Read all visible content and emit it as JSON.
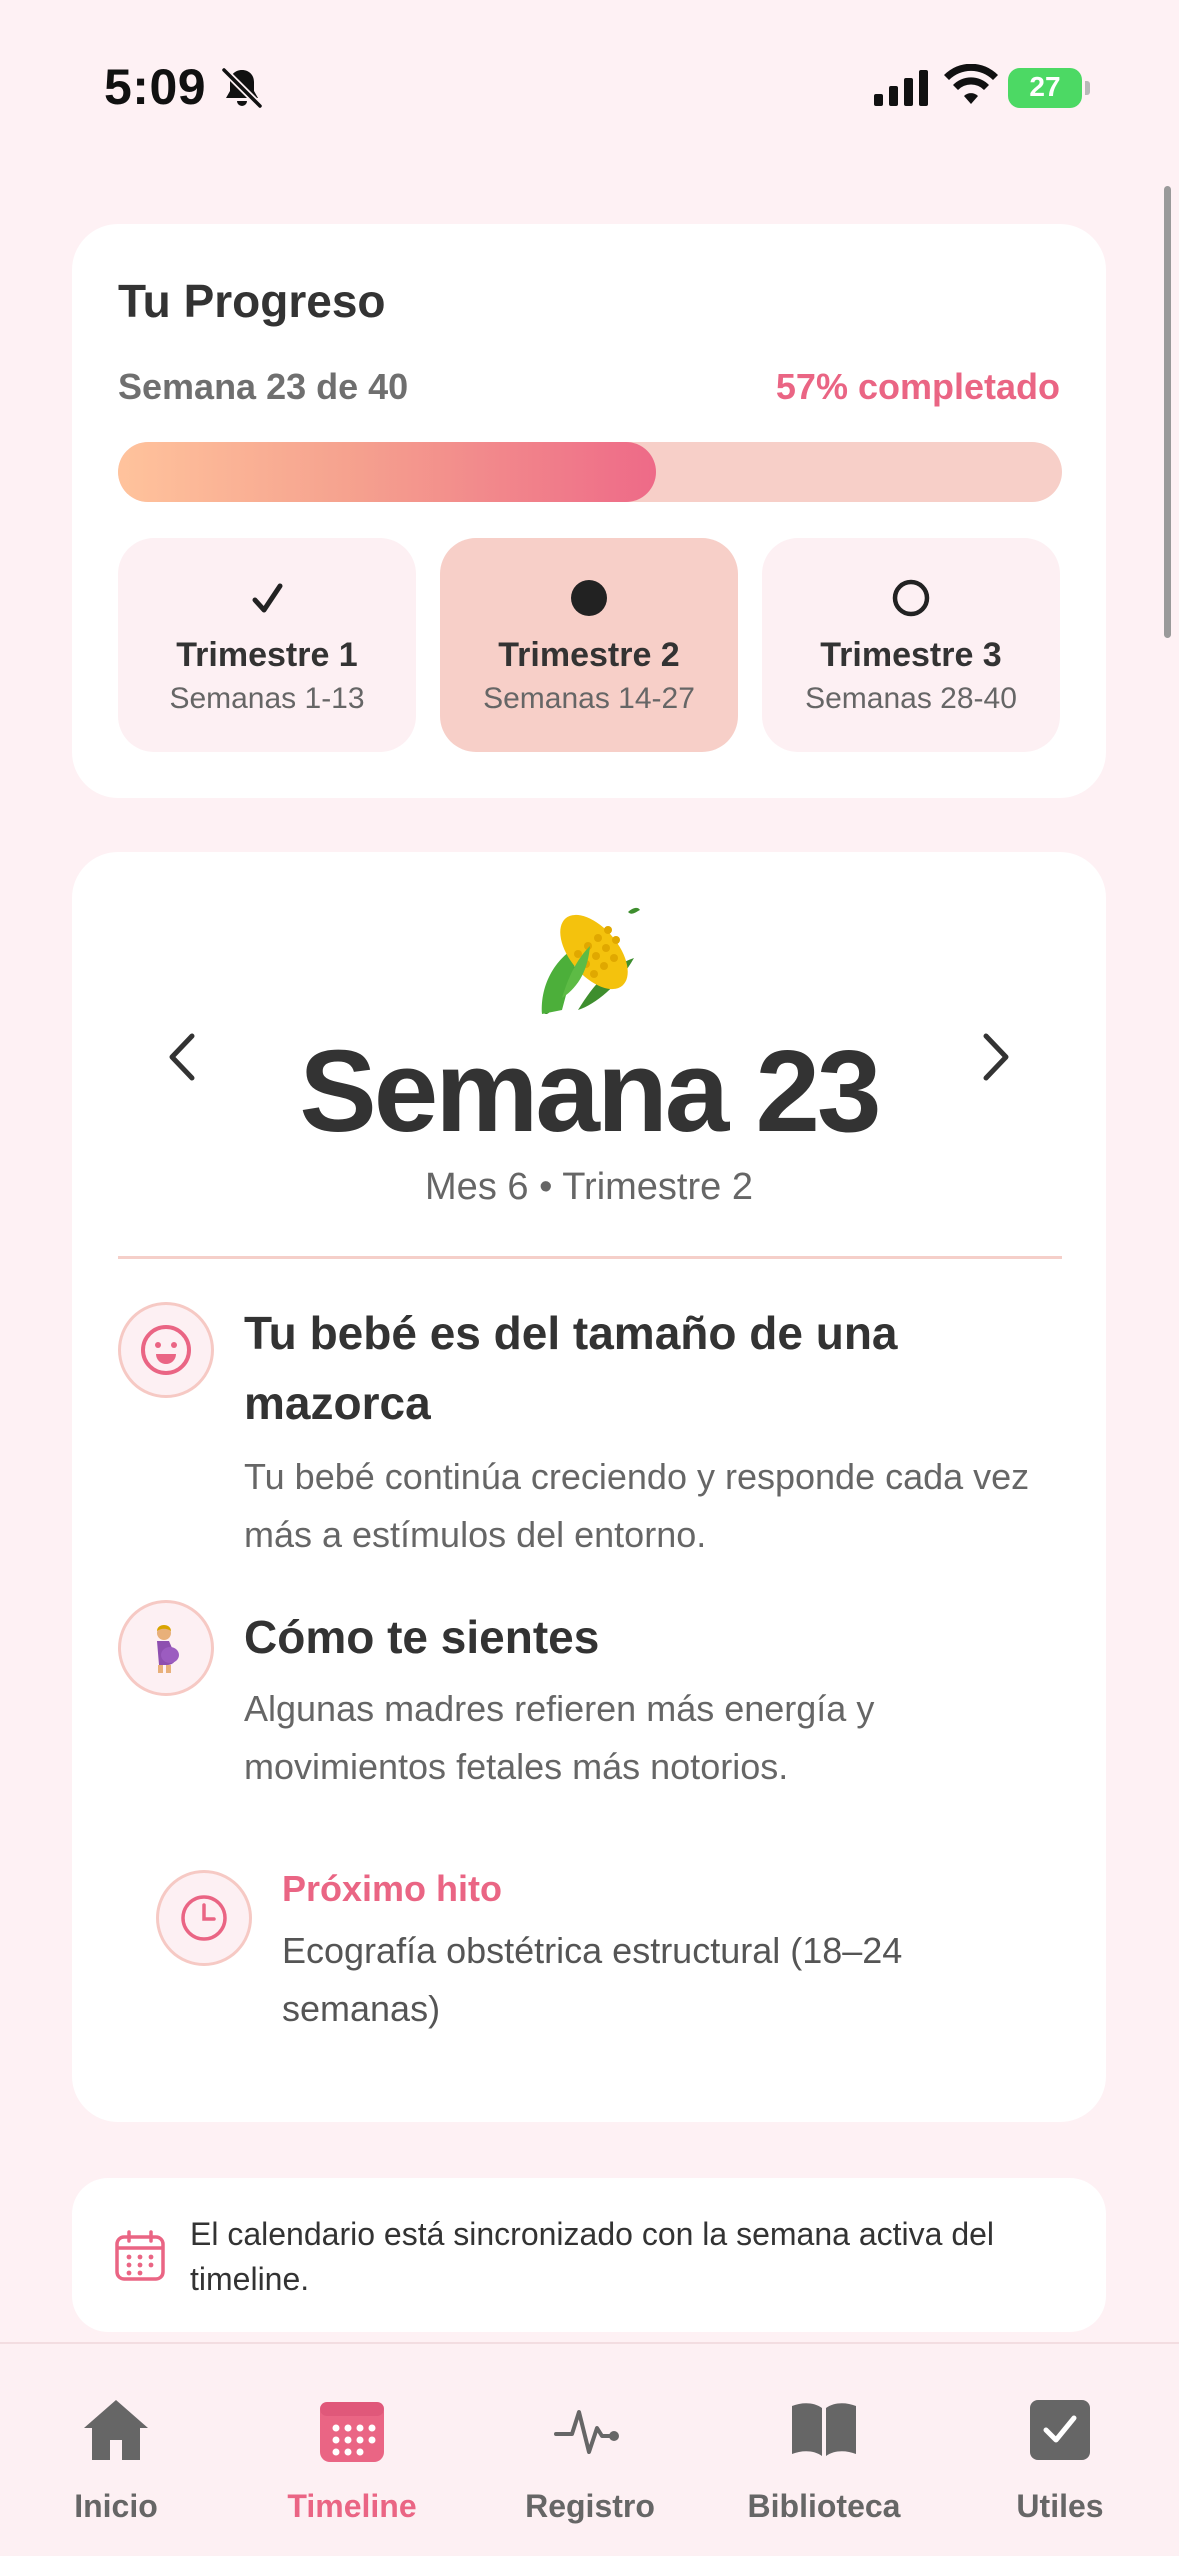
{
  "status_bar": {
    "time": "5:09",
    "battery": "27"
  },
  "progress": {
    "title": "Tu Progreso",
    "week_of": "Semana 23 de 40",
    "percent_label": "57% completado",
    "percent_value": 57,
    "trimesters": [
      {
        "title": "Trimestre 1",
        "weeks": "Semanas 1-13",
        "state": "completed"
      },
      {
        "title": "Trimestre 2",
        "weeks": "Semanas 14-27",
        "state": "current"
      },
      {
        "title": "Trimestre 3",
        "weeks": "Semanas 28-40",
        "state": "upcoming"
      }
    ]
  },
  "week": {
    "emoji_icon": "corn",
    "title": "Semana 23",
    "meta": "Mes 6 • Trimestre 2",
    "baby_size_title": "Tu bebé es del tamaño de una mazorca",
    "baby_size_text": "Tu bebé continúa creciendo y responde cada vez más a estímulos del entorno.",
    "feel_title": "Cómo te sientes",
    "feel_text": "Algunas madres refieren más energía y movimientos fetales más notorios.",
    "milestone_label": "Próximo hito",
    "milestone_text": "Ecografía obstétrica estructural (18–24 semanas)"
  },
  "sync_notice": "El calendario está sincronizado con la semana activa del timeline.",
  "tabs": [
    {
      "label": "Inicio",
      "icon": "house-icon"
    },
    {
      "label": "Timeline",
      "icon": "calendar-icon",
      "active": true
    },
    {
      "label": "Registro",
      "icon": "heartbeat-icon"
    },
    {
      "label": "Biblioteca",
      "icon": "book-icon"
    },
    {
      "label": "Utiles",
      "icon": "checkbox-icon"
    }
  ],
  "colors": {
    "accent": "#EA6584",
    "background": "#FEF1F4",
    "trimester_active": "#F7CFC8"
  }
}
